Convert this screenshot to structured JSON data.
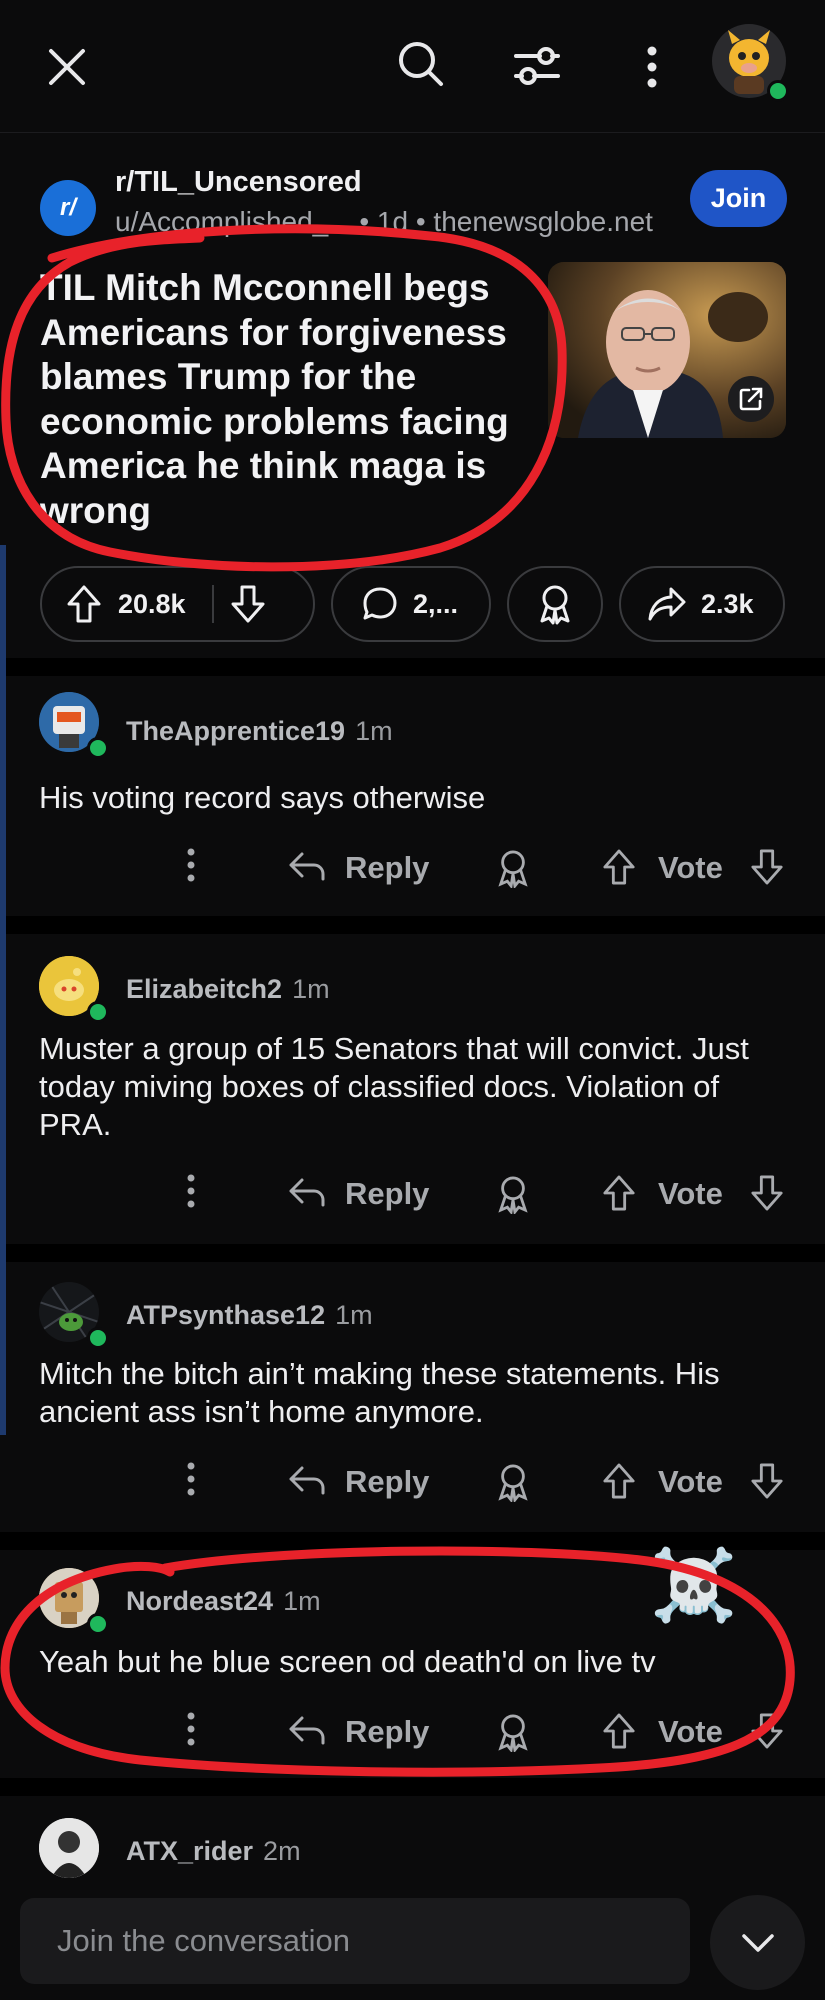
{
  "post": {
    "subreddit": "r/TIL_Uncensored",
    "sub_icon_text": "r/",
    "meta": "u/Accomplished_... • 1d • thenewsglobe.net",
    "join_label": "Join",
    "title": "TIL Mitch Mcconnell begs Americans for forgiveness blames Trump for the economic problems facing America he think maga is wrong",
    "upvotes": "20.8k",
    "comments": "2,...",
    "shares": "2.3k"
  },
  "comments": [
    {
      "user": "TheApprentice19",
      "time": "1m",
      "body": "His voting record says otherwise",
      "reply": "Reply",
      "vote": "Vote"
    },
    {
      "user": "Elizabeitch2",
      "time": "1m",
      "body": "Muster a group of 15 Senators that will convict. Just today miving boxes of classified docs. Violation of PRA.",
      "reply": "Reply",
      "vote": "Vote"
    },
    {
      "user": "ATPsynthase12",
      "time": "1m",
      "body": "Mitch the bitch ain’t making these statements. His ancient ass isn’t home anymore.",
      "reply": "Reply",
      "vote": "Vote"
    },
    {
      "user": "Nordeast24",
      "time": "1m",
      "body": "Yeah but he blue screen od death'd on live tv",
      "reply": "Reply",
      "vote": "Vote"
    },
    {
      "user": "ATX_rider",
      "time": "2m"
    }
  ],
  "overlay": {
    "skull_emoji": "☠️"
  },
  "composer": {
    "placeholder": "Join the conversation"
  },
  "colors": {
    "background": "#0b0b0c",
    "join_button": "#1f55c7",
    "annotation_red": "#e8222a",
    "online_dot": "#1fb85c"
  }
}
